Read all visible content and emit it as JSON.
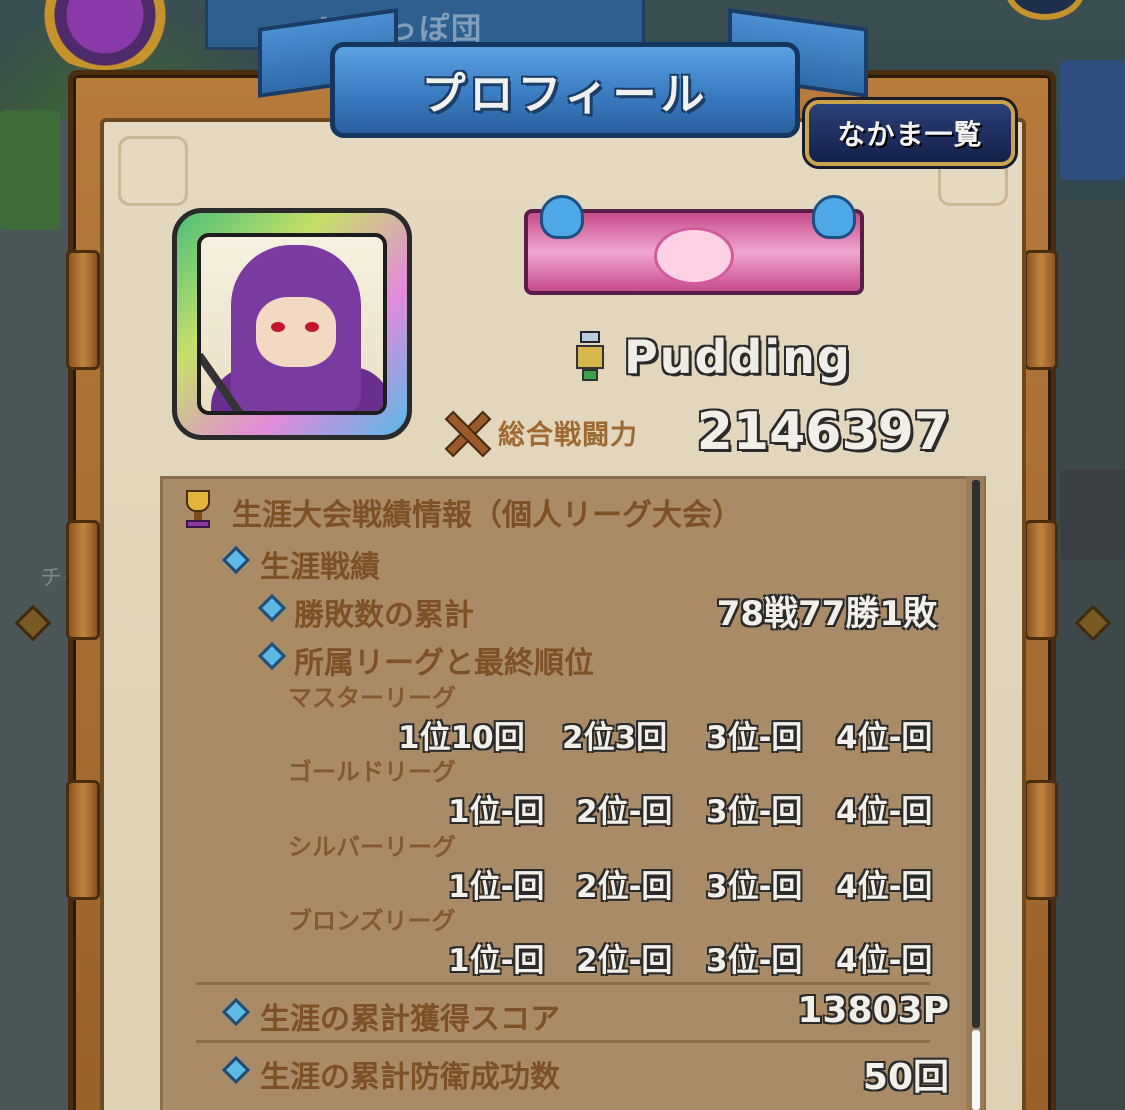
{
  "background": {
    "sign_text": "Wいっぽ団",
    "side_text": "チャ"
  },
  "header": {
    "title": "プロフィール",
    "nakama_button": "なかま一覧"
  },
  "profile": {
    "player_name": "Pudding",
    "power_label": "総合戦闘力",
    "power_value": "2146397"
  },
  "stats": {
    "section_title": "生涯大会戦績情報（個人リーグ大会）",
    "subsection_title": "生涯戦績",
    "win_loss_label": "勝敗数の累計",
    "win_loss_value": "78戦77勝1敗",
    "league_heading": "所属リーグと最終順位",
    "leagues": [
      {
        "name": "マスターリーグ",
        "ranks": [
          "1位10回",
          "2位3回",
          "3位-回",
          "4位-回"
        ]
      },
      {
        "name": "ゴールドリーグ",
        "ranks": [
          "1位-回",
          "2位-回",
          "3位-回",
          "4位-回"
        ]
      },
      {
        "name": "シルバーリーグ",
        "ranks": [
          "1位-回",
          "2位-回",
          "3位-回",
          "4位-回"
        ]
      },
      {
        "name": "ブロンズリーグ",
        "ranks": [
          "1位-回",
          "2位-回",
          "3位-回",
          "4位-回"
        ]
      }
    ],
    "score_label": "生涯の累計獲得スコア",
    "score_value": "13803P",
    "defense_label": "生涯の累計防衛成功数",
    "defense_value": "50回"
  },
  "colors": {
    "ribbon_blue": "#3a7cc2",
    "panel_brown": "#a98b67",
    "label_brown": "#7c5128",
    "diamond_blue": "#5db9e6"
  }
}
